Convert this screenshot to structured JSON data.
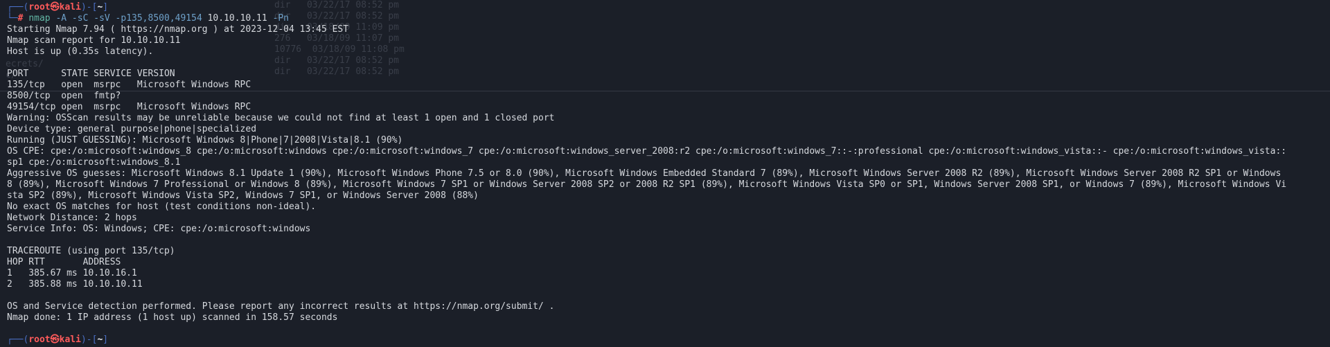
{
  "window": {
    "background": "#1b1f28"
  },
  "ghost": {
    "left_text_1": "ecrets/",
    "left_text_2": "c/",
    "rows": [
      "dir   03/22/17 08:52 pm",
      "dir   03/22/17 08:52 pm",
      "dir   03/18/09 11:09 pm",
      "276   03/18/09 11:07 pm",
      "10776  03/18/09 11:08 pm",
      "dir   03/22/17 08:52 pm",
      "dir   03/22/17 08:52 pm"
    ]
  },
  "prompt": {
    "open": "┌──(",
    "user": "root",
    "skull": "㉿",
    "host": "kali",
    "mid": ")-[",
    "cwd": "~",
    "close": "]",
    "second_line": "└─",
    "hash": "#"
  },
  "command": {
    "program": "nmap",
    "flags": "-A -sC -sV -p135,8500,49154",
    "target": "10.10.10.11",
    "extra": "-Pn"
  },
  "output": [
    "Starting Nmap 7.94 ( https://nmap.org ) at 2023-12-04 13:45 EST",
    "Nmap scan report for 10.10.10.11",
    "Host is up (0.35s latency).",
    "",
    "PORT      STATE SERVICE VERSION",
    "135/tcp   open  msrpc   Microsoft Windows RPC",
    "8500/tcp  open  fmtp?",
    "49154/tcp open  msrpc   Microsoft Windows RPC",
    "Warning: OSScan results may be unreliable because we could not find at least 1 open and 1 closed port",
    "Device type: general purpose|phone|specialized",
    "Running (JUST GUESSING): Microsoft Windows 8|Phone|7|2008|Vista|8.1 (90%)",
    "OS CPE: cpe:/o:microsoft:windows_8 cpe:/o:microsoft:windows cpe:/o:microsoft:windows_7 cpe:/o:microsoft:windows_server_2008:r2 cpe:/o:microsoft:windows_7::-:professional cpe:/o:microsoft:windows_vista::- cpe:/o:microsoft:windows_vista::",
    "sp1 cpe:/o:microsoft:windows_8.1",
    "Aggressive OS guesses: Microsoft Windows 8.1 Update 1 (90%), Microsoft Windows Phone 7.5 or 8.0 (90%), Microsoft Windows Embedded Standard 7 (89%), Microsoft Windows Server 2008 R2 (89%), Microsoft Windows Server 2008 R2 SP1 or Windows",
    "8 (89%), Microsoft Windows 7 Professional or Windows 8 (89%), Microsoft Windows 7 SP1 or Windows Server 2008 SP2 or 2008 R2 SP1 (89%), Microsoft Windows Vista SP0 or SP1, Windows Server 2008 SP1, or Windows 7 (89%), Microsoft Windows Vi",
    "sta SP2 (89%), Microsoft Windows Vista SP2, Windows 7 SP1, or Windows Server 2008 (88%)",
    "No exact OS matches for host (test conditions non-ideal).",
    "Network Distance: 2 hops",
    "Service Info: OS: Windows; CPE: cpe:/o:microsoft:windows",
    "",
    "TRACEROUTE (using port 135/tcp)",
    "HOP RTT       ADDRESS",
    "1   385.67 ms 10.10.16.1",
    "2   385.88 ms 10.10.10.11",
    "",
    "OS and Service detection performed. Please report any incorrect results at https://nmap.org/submit/ .",
    "Nmap done: 1 IP address (1 host up) scanned in 158.57 seconds",
    ""
  ],
  "colors": {
    "user": "#ff5b5b",
    "bracket": "#4a6fc4",
    "command": "#62b6a4",
    "text": "#d6d9de"
  }
}
